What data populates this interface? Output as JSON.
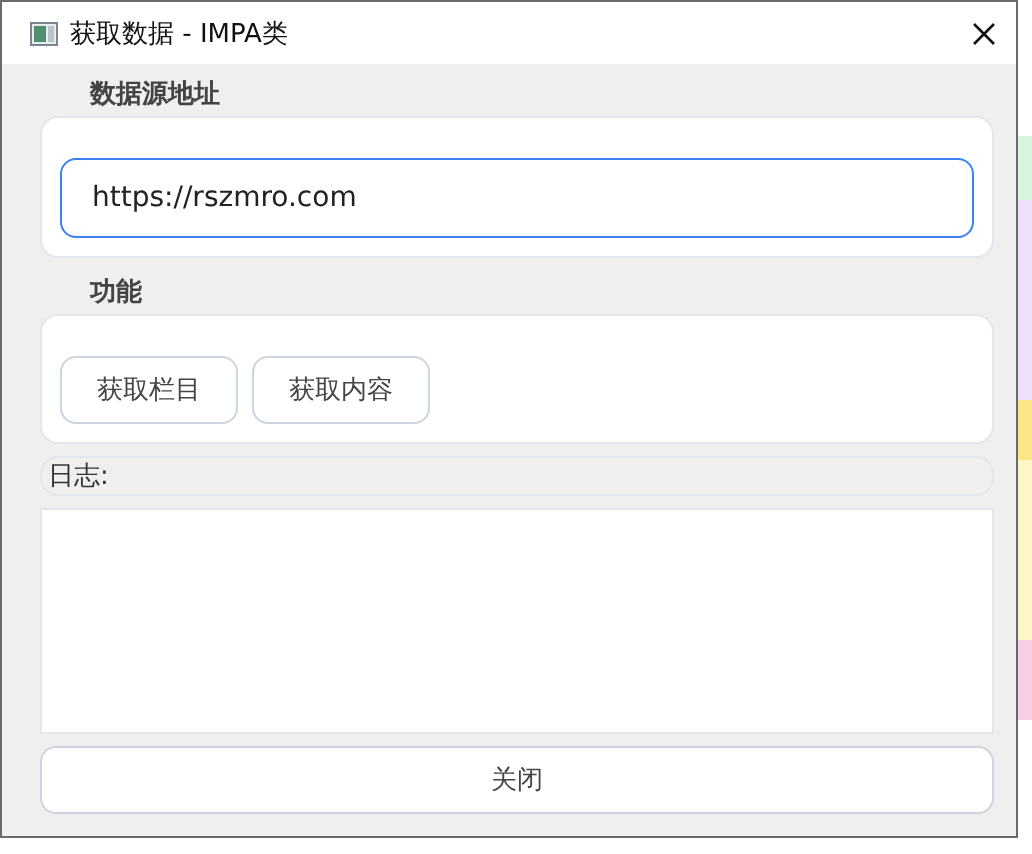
{
  "window": {
    "title": "获取数据 - IMPA类"
  },
  "source_group": {
    "title": "数据源地址",
    "url": {
      "value": "https://rszmro.com",
      "focused": true
    }
  },
  "function_group": {
    "title": "功能",
    "buttons": [
      "获取栏目",
      "获取内容"
    ]
  },
  "log": {
    "label": "日志:"
  },
  "close_button": "关闭"
}
